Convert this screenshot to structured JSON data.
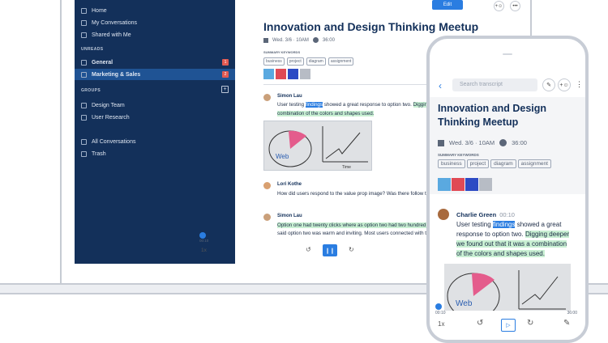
{
  "sidebar": {
    "items": [
      {
        "label": "Home"
      },
      {
        "label": "My Conversations"
      },
      {
        "label": "Shared with Me"
      }
    ],
    "unreads_heading": "UNREADS",
    "unreads": [
      {
        "label": "General",
        "badge": "1"
      },
      {
        "label": "Marketing & Sales",
        "badge": "2"
      }
    ],
    "groups_heading": "GROUPS",
    "groups_add": "+",
    "groups": [
      {
        "label": "Design Team"
      },
      {
        "label": "User Research"
      }
    ],
    "footer": [
      {
        "label": "All Conversations"
      },
      {
        "label": "Trash"
      }
    ]
  },
  "toolbar": {
    "edit_label": "Edit",
    "share_icon": "add-user-icon",
    "more_label": "•••"
  },
  "meeting": {
    "title": "Innovation and Design Thinking Meetup",
    "date": "Wed. 3/6 · 10AM",
    "duration": "36:00",
    "keywords_label": "SUMMARY KEYWORDS",
    "keywords": [
      "business",
      "project",
      "diagram",
      "assignment"
    ]
  },
  "transcript": [
    {
      "speaker": "Simon Lau",
      "l1a": "User testing ",
      "l1b": "findings",
      "l1c": " showed a great response to option two. ",
      "l1d": "Digging deeper we found out",
      "l2": "combination of the colors and shapes used."
    },
    {
      "speaker": "Lori Kothe",
      "l1": "How did users respond to the value prop image? Was there follow through with the call to"
    },
    {
      "speaker": "Simon Lau",
      "l1": "Option one had twenty clicks where as option two had two hundred and seventeen clicks.",
      "l2": "said option two was warm and inviting. Most users connected with the benefits and agree"
    }
  ],
  "player": {
    "position": "00:10",
    "speed": "1x",
    "rewind": "↺",
    "play": "❙❙",
    "forward": "↻"
  },
  "sketch": {
    "word1": "Web",
    "word2": "Time"
  },
  "phone": {
    "back": "‹",
    "search_placeholder": "Search transcript",
    "title": "Innovation and Design Thinking Meetup",
    "date": "Wed. 3/6 · 10AM",
    "duration": "36:00",
    "keywords_label": "SUMMARY KEYWORDS",
    "keywords": [
      "business",
      "project",
      "diagram",
      "assignment"
    ],
    "speaker": "Charlie Green",
    "speaker_time": "00:10",
    "l1a": "User testing ",
    "l1b": "findings",
    "l1c": " showed a great",
    "l2a": "response to option two. ",
    "l2b": "Digging deeper",
    "l3": "we found out that it was a combination",
    "l4": "of the colors and shapes used.",
    "time_start": "00:10",
    "time_end": "36:00",
    "speed": "1x",
    "rewind": "↺",
    "play": "▷",
    "forward": "↻",
    "edit_icon": "✎",
    "sketch_word": "Web"
  }
}
